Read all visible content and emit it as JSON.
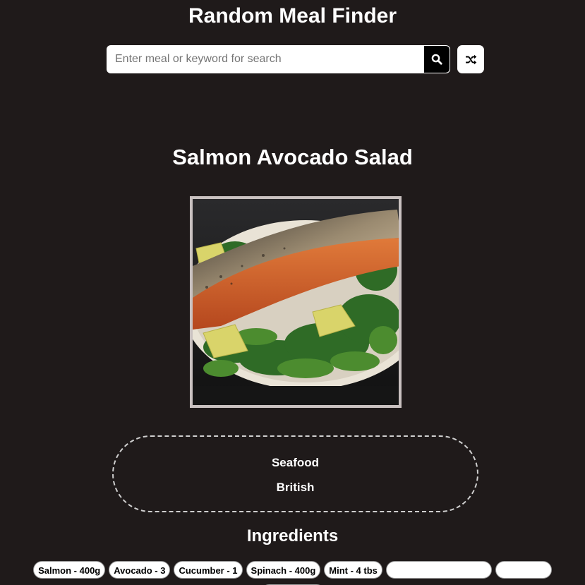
{
  "header": {
    "title": "Random Meal Finder",
    "search_placeholder": "Enter meal or keyword for search",
    "search_value": ""
  },
  "meal": {
    "title": "Salmon Avocado Salad",
    "category": "Seafood",
    "area": "British"
  },
  "ingredients": {
    "heading": "Ingredients",
    "items": [
      "Salmon - 400g",
      "Avocado - 3",
      "Cucumber - 1",
      "Spinach - 400g",
      "Mint - 4 tbs"
    ]
  },
  "colors": {
    "background": "#1f1a1a",
    "search_button": "#000000",
    "image_border": "#c9c1c0"
  },
  "icons": {
    "search": "search-icon",
    "random": "shuffle-icon"
  }
}
